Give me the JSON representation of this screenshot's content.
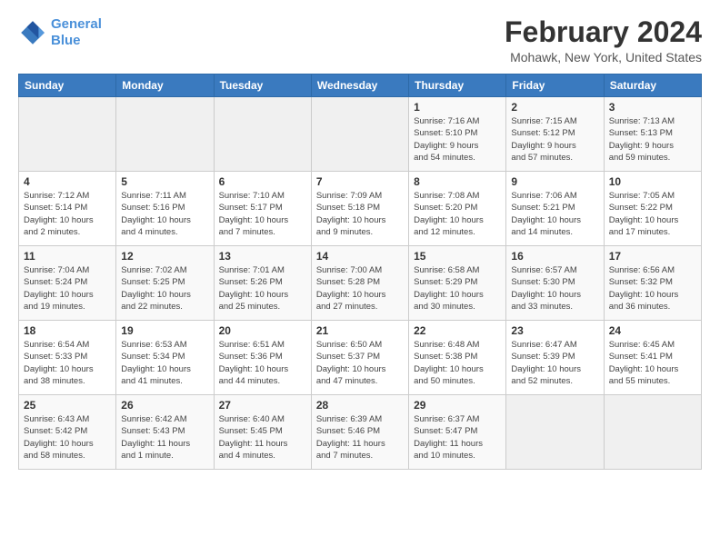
{
  "logo": {
    "line1": "General",
    "line2": "Blue"
  },
  "title": "February 2024",
  "location": "Mohawk, New York, United States",
  "days_of_week": [
    "Sunday",
    "Monday",
    "Tuesday",
    "Wednesday",
    "Thursday",
    "Friday",
    "Saturday"
  ],
  "weeks": [
    [
      {
        "day": "",
        "info": ""
      },
      {
        "day": "",
        "info": ""
      },
      {
        "day": "",
        "info": ""
      },
      {
        "day": "",
        "info": ""
      },
      {
        "day": "1",
        "info": "Sunrise: 7:16 AM\nSunset: 5:10 PM\nDaylight: 9 hours\nand 54 minutes."
      },
      {
        "day": "2",
        "info": "Sunrise: 7:15 AM\nSunset: 5:12 PM\nDaylight: 9 hours\nand 57 minutes."
      },
      {
        "day": "3",
        "info": "Sunrise: 7:13 AM\nSunset: 5:13 PM\nDaylight: 9 hours\nand 59 minutes."
      }
    ],
    [
      {
        "day": "4",
        "info": "Sunrise: 7:12 AM\nSunset: 5:14 PM\nDaylight: 10 hours\nand 2 minutes."
      },
      {
        "day": "5",
        "info": "Sunrise: 7:11 AM\nSunset: 5:16 PM\nDaylight: 10 hours\nand 4 minutes."
      },
      {
        "day": "6",
        "info": "Sunrise: 7:10 AM\nSunset: 5:17 PM\nDaylight: 10 hours\nand 7 minutes."
      },
      {
        "day": "7",
        "info": "Sunrise: 7:09 AM\nSunset: 5:18 PM\nDaylight: 10 hours\nand 9 minutes."
      },
      {
        "day": "8",
        "info": "Sunrise: 7:08 AM\nSunset: 5:20 PM\nDaylight: 10 hours\nand 12 minutes."
      },
      {
        "day": "9",
        "info": "Sunrise: 7:06 AM\nSunset: 5:21 PM\nDaylight: 10 hours\nand 14 minutes."
      },
      {
        "day": "10",
        "info": "Sunrise: 7:05 AM\nSunset: 5:22 PM\nDaylight: 10 hours\nand 17 minutes."
      }
    ],
    [
      {
        "day": "11",
        "info": "Sunrise: 7:04 AM\nSunset: 5:24 PM\nDaylight: 10 hours\nand 19 minutes."
      },
      {
        "day": "12",
        "info": "Sunrise: 7:02 AM\nSunset: 5:25 PM\nDaylight: 10 hours\nand 22 minutes."
      },
      {
        "day": "13",
        "info": "Sunrise: 7:01 AM\nSunset: 5:26 PM\nDaylight: 10 hours\nand 25 minutes."
      },
      {
        "day": "14",
        "info": "Sunrise: 7:00 AM\nSunset: 5:28 PM\nDaylight: 10 hours\nand 27 minutes."
      },
      {
        "day": "15",
        "info": "Sunrise: 6:58 AM\nSunset: 5:29 PM\nDaylight: 10 hours\nand 30 minutes."
      },
      {
        "day": "16",
        "info": "Sunrise: 6:57 AM\nSunset: 5:30 PM\nDaylight: 10 hours\nand 33 minutes."
      },
      {
        "day": "17",
        "info": "Sunrise: 6:56 AM\nSunset: 5:32 PM\nDaylight: 10 hours\nand 36 minutes."
      }
    ],
    [
      {
        "day": "18",
        "info": "Sunrise: 6:54 AM\nSunset: 5:33 PM\nDaylight: 10 hours\nand 38 minutes."
      },
      {
        "day": "19",
        "info": "Sunrise: 6:53 AM\nSunset: 5:34 PM\nDaylight: 10 hours\nand 41 minutes."
      },
      {
        "day": "20",
        "info": "Sunrise: 6:51 AM\nSunset: 5:36 PM\nDaylight: 10 hours\nand 44 minutes."
      },
      {
        "day": "21",
        "info": "Sunrise: 6:50 AM\nSunset: 5:37 PM\nDaylight: 10 hours\nand 47 minutes."
      },
      {
        "day": "22",
        "info": "Sunrise: 6:48 AM\nSunset: 5:38 PM\nDaylight: 10 hours\nand 50 minutes."
      },
      {
        "day": "23",
        "info": "Sunrise: 6:47 AM\nSunset: 5:39 PM\nDaylight: 10 hours\nand 52 minutes."
      },
      {
        "day": "24",
        "info": "Sunrise: 6:45 AM\nSunset: 5:41 PM\nDaylight: 10 hours\nand 55 minutes."
      }
    ],
    [
      {
        "day": "25",
        "info": "Sunrise: 6:43 AM\nSunset: 5:42 PM\nDaylight: 10 hours\nand 58 minutes."
      },
      {
        "day": "26",
        "info": "Sunrise: 6:42 AM\nSunset: 5:43 PM\nDaylight: 11 hours\nand 1 minute."
      },
      {
        "day": "27",
        "info": "Sunrise: 6:40 AM\nSunset: 5:45 PM\nDaylight: 11 hours\nand 4 minutes."
      },
      {
        "day": "28",
        "info": "Sunrise: 6:39 AM\nSunset: 5:46 PM\nDaylight: 11 hours\nand 7 minutes."
      },
      {
        "day": "29",
        "info": "Sunrise: 6:37 AM\nSunset: 5:47 PM\nDaylight: 11 hours\nand 10 minutes."
      },
      {
        "day": "",
        "info": ""
      },
      {
        "day": "",
        "info": ""
      }
    ]
  ]
}
